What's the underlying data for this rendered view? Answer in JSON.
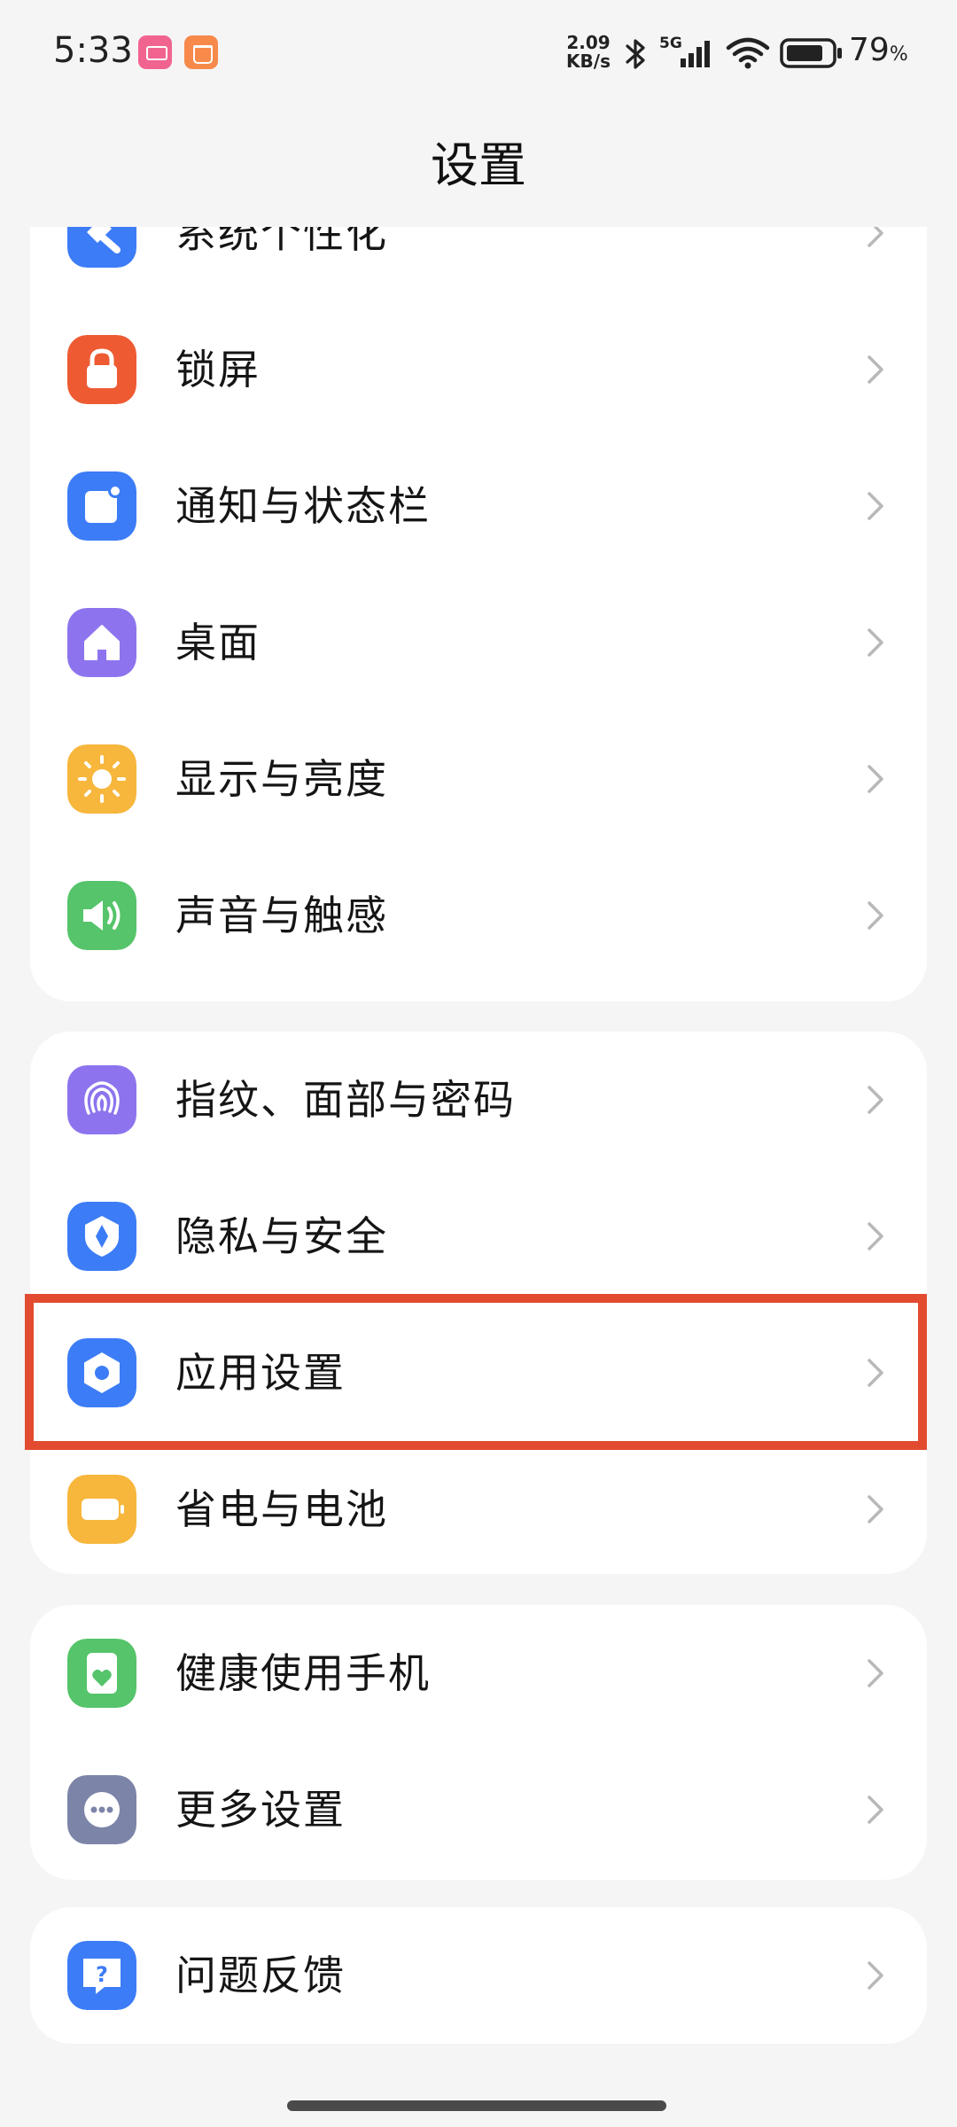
{
  "status_bar": {
    "time": "5:33",
    "net_speed_value": "2.09",
    "net_speed_unit": "KB/s",
    "network_type": "5G",
    "battery_percent": "79",
    "battery_percent_sign": "%"
  },
  "header": {
    "title": "设置"
  },
  "groups": [
    {
      "items": [
        {
          "label": "系统个性化",
          "icon": "personalization-icon",
          "color": "#3c7cf6"
        },
        {
          "label": "锁屏",
          "icon": "lock-icon",
          "color": "#ee5b33"
        },
        {
          "label": "通知与状态栏",
          "icon": "notification-icon",
          "color": "#3c7cf6"
        },
        {
          "label": "桌面",
          "icon": "home-icon",
          "color": "#8d74ee"
        },
        {
          "label": "显示与亮度",
          "icon": "sun-icon",
          "color": "#f7b63c"
        },
        {
          "label": "声音与触感",
          "icon": "speaker-icon",
          "color": "#55c46a"
        }
      ]
    },
    {
      "items": [
        {
          "label": "指纹、面部与密码",
          "icon": "fingerprint-icon",
          "color": "#8d74ee"
        },
        {
          "label": "隐私与安全",
          "icon": "privacy-shield-icon",
          "color": "#3c7cf6"
        },
        {
          "label": "应用设置",
          "icon": "app-settings-icon",
          "color": "#3c7cf6"
        },
        {
          "label": "省电与电池",
          "icon": "battery-saver-icon",
          "color": "#f7b63c"
        }
      ]
    },
    {
      "items": [
        {
          "label": "健康使用手机",
          "icon": "health-icon",
          "color": "#55c46a"
        },
        {
          "label": "更多设置",
          "icon": "more-icon",
          "color": "#7c84a8"
        }
      ]
    },
    {
      "items": [
        {
          "label": "问题反馈",
          "icon": "feedback-icon",
          "color": "#3c7cf6"
        }
      ]
    }
  ],
  "highlight_color": "#e24b2f"
}
